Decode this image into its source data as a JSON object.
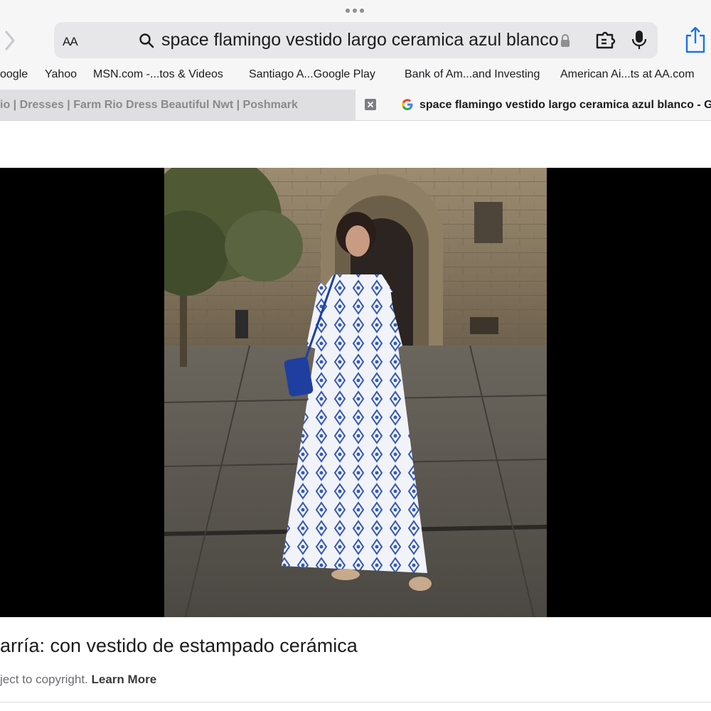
{
  "browser": {
    "reader_label": "AA",
    "search_query": "space flamingo vestido largo ceramica azul blanco",
    "icons": [
      "more-dots-icon",
      "forward-arrow-icon",
      "search-icon",
      "lock-icon",
      "extensions-icon",
      "microphone-icon",
      "share-icon"
    ]
  },
  "bookmarks": [
    "oogle",
    "Yahoo",
    "MSN.com -...tos & Videos",
    "Santiago A...Google Play",
    "Bank of Am...and Investing",
    "American Ai...ts at AA.com"
  ],
  "tabs": [
    {
      "title": "io | Dresses | Farm Rio Dress Beautiful Nwt | Poshmark",
      "active": false
    },
    {
      "title": "space flamingo vestido largo ceramica azul blanco - G",
      "active": true
    }
  ],
  "image_viewer": {
    "caption": "arría: con vestido de estampado cerámica",
    "copyright_text": "ject to copyright.",
    "learn_more_label": "Learn More"
  },
  "colors": {
    "accent": "#1a73e8",
    "chrome_bg": "#f6f6f7",
    "address_bg": "#e7e7ea"
  }
}
